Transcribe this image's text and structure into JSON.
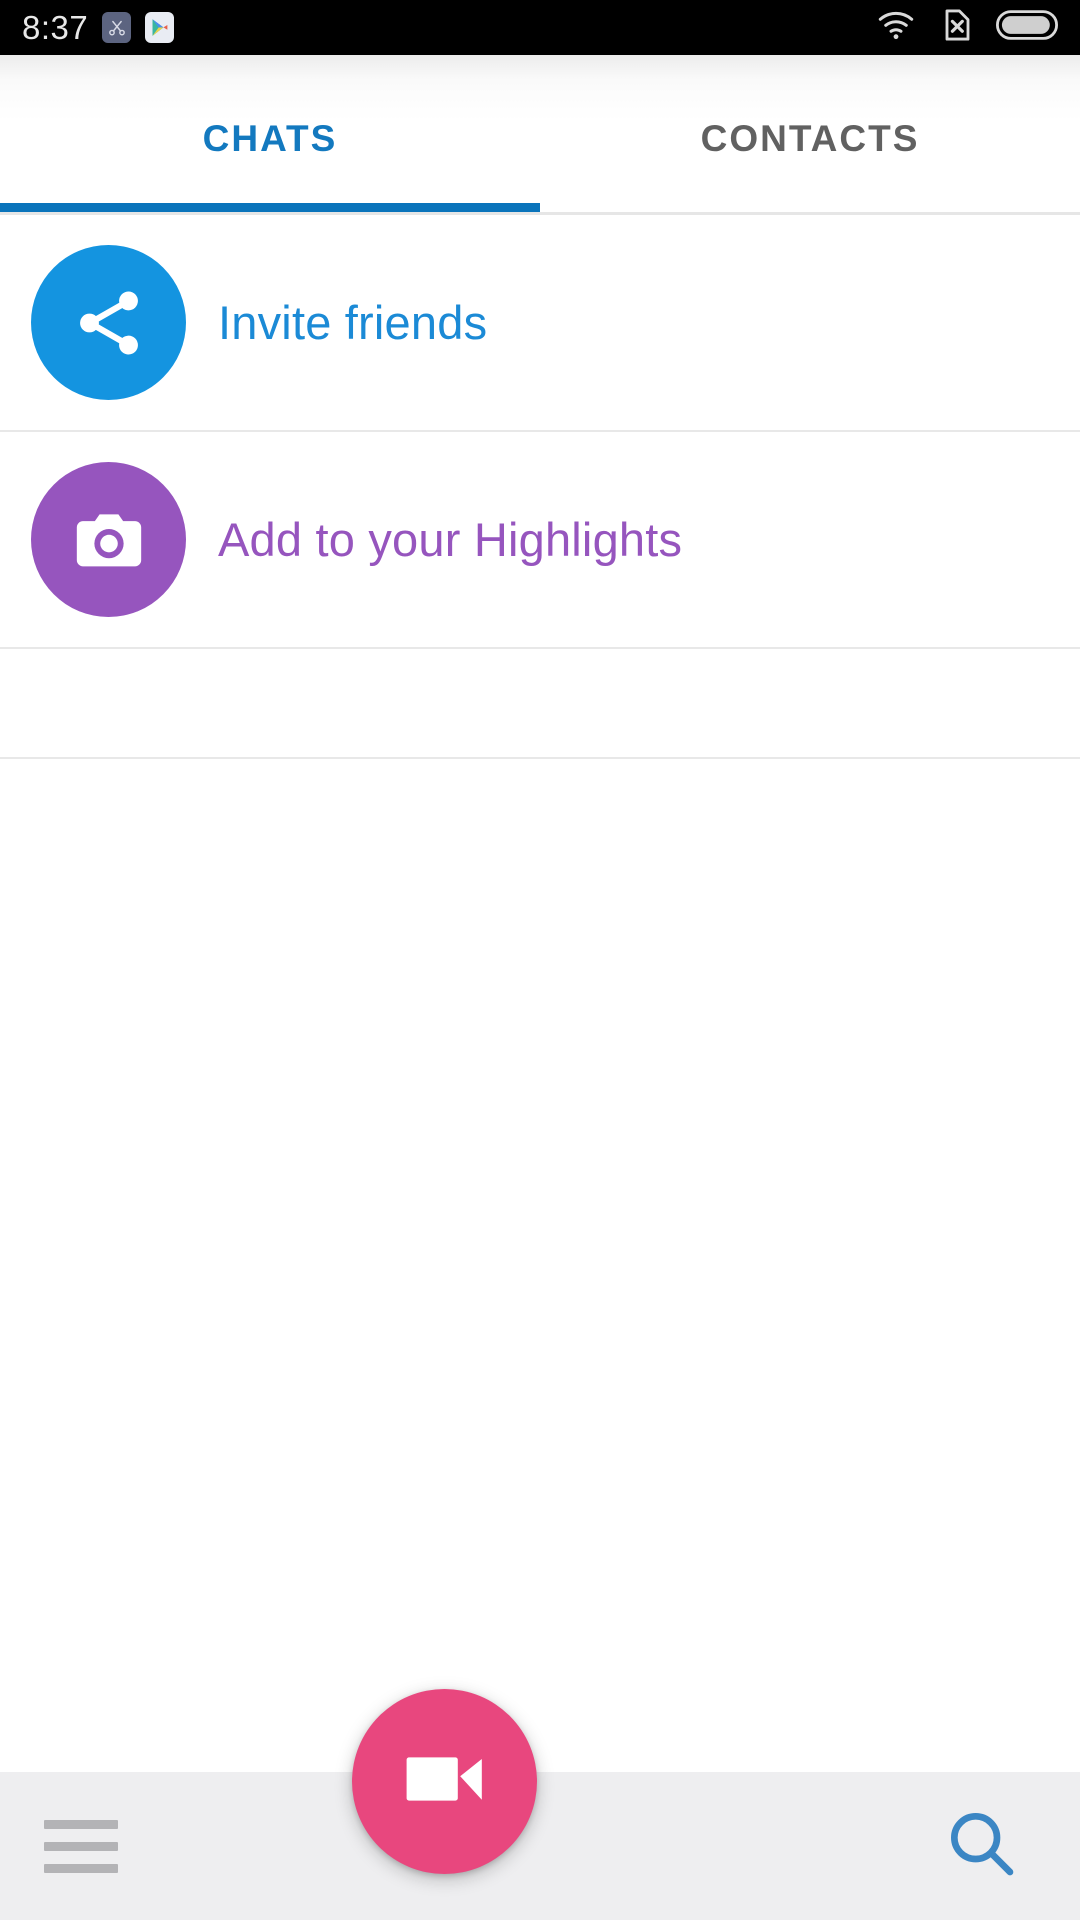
{
  "status_bar": {
    "time": "8:37",
    "left_icons": [
      {
        "name": "screenshot-icon",
        "label": "screenshot"
      },
      {
        "name": "play-store-icon",
        "label": "play-store"
      }
    ],
    "right_icons": [
      {
        "name": "wifi-icon",
        "label": "wifi"
      },
      {
        "name": "no-sim-icon",
        "label": "no-sim"
      },
      {
        "name": "battery-icon",
        "label": "battery"
      }
    ]
  },
  "tabs": [
    {
      "label": "CHATS",
      "active": true
    },
    {
      "label": "CONTACTS",
      "active": false
    }
  ],
  "list": {
    "rows": [
      {
        "label": "Invite friends",
        "icon": "share-icon",
        "color": "#1494e0",
        "text_color": "#1b8ad6"
      },
      {
        "label": "Add to your Highlights",
        "icon": "camera-icon",
        "color": "#9655be",
        "text_color": "#9655be"
      }
    ]
  },
  "bottom_bar": {
    "menu_label": "menu",
    "search_label": "search",
    "fab_label": "new video call",
    "fab_color": "#e8477e",
    "search_color": "#3b86c4",
    "menu_color": "#b3b3b6"
  },
  "colors": {
    "accent_blue": "#0a74bb",
    "tab_active": "#1379bf",
    "tab_inactive": "#616161",
    "bottom_bar_bg": "#eeeef0",
    "divider": "#e8e8e8"
  }
}
